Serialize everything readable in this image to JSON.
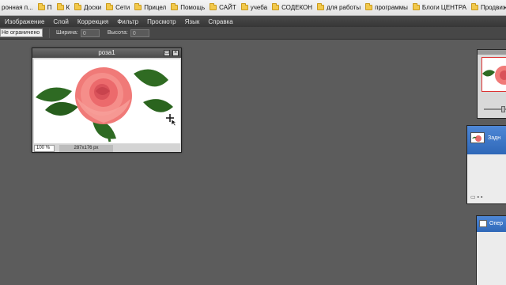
{
  "bookmarks": [
    {
      "label": "ронная п...",
      "folder": false
    },
    {
      "label": "П",
      "folder": true
    },
    {
      "label": "К",
      "folder": true
    },
    {
      "label": "Доски",
      "folder": true
    },
    {
      "label": "Сети",
      "folder": true
    },
    {
      "label": "Прицел",
      "folder": true
    },
    {
      "label": "Помощь",
      "folder": true
    },
    {
      "label": "САЙТ",
      "folder": true
    },
    {
      "label": "учеба",
      "folder": true
    },
    {
      "label": "СОДЕКОН",
      "folder": true
    },
    {
      "label": "для работы",
      "folder": true
    },
    {
      "label": "программы",
      "folder": true
    },
    {
      "label": "Блоги ЦЕНТРА",
      "folder": true
    },
    {
      "label": "Продвижение",
      "folder": true
    }
  ],
  "menu": [
    "Изображение",
    "Слой",
    "Коррекция",
    "Фильтр",
    "Просмотр",
    "Язык",
    "Справка"
  ],
  "options": {
    "constraint_value": "Не ограничено",
    "width_label": "Ширина:",
    "width_value": "0",
    "height_label": "Высота:",
    "height_value": "0"
  },
  "document": {
    "title": "роза1",
    "zoom": "100",
    "zoom_unit": "%",
    "dimensions": "287x176 px"
  },
  "panels": {
    "layers_title": "Задн",
    "history_title": "Опер"
  },
  "colors": {
    "workspace": "#5c5c5c",
    "panel_header": "#3a73c4",
    "rose": "#f27c7c",
    "leaf": "#2f6b22"
  }
}
